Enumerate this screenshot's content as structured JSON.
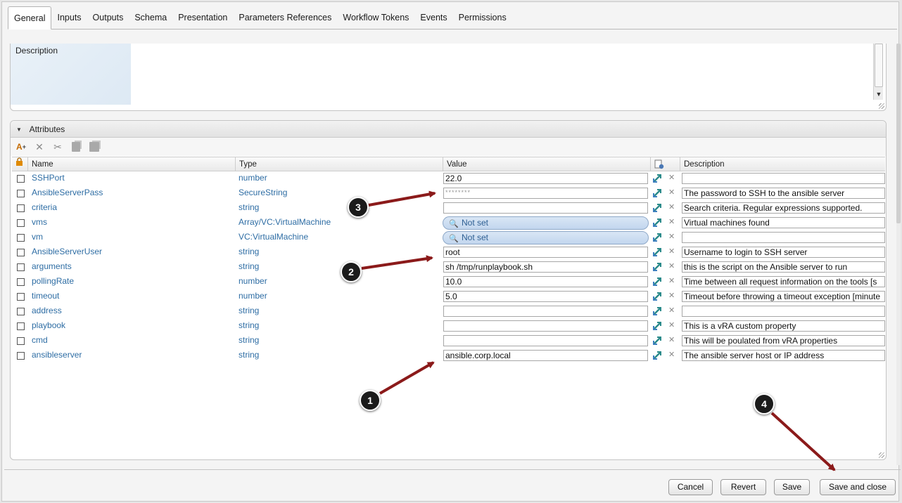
{
  "tabs": [
    {
      "label": "General",
      "active": true
    },
    {
      "label": "Inputs"
    },
    {
      "label": "Outputs"
    },
    {
      "label": "Schema"
    },
    {
      "label": "Presentation"
    },
    {
      "label": "Parameters References"
    },
    {
      "label": "Workflow Tokens"
    },
    {
      "label": "Events"
    },
    {
      "label": "Permissions"
    }
  ],
  "description": {
    "label": "Description"
  },
  "attributes": {
    "title": "Attributes",
    "columns": {
      "name": "Name",
      "type": "Type",
      "value": "Value",
      "description": "Description"
    },
    "rows": [
      {
        "name": "SSHPort",
        "type": "number",
        "value": "22.0",
        "description": ""
      },
      {
        "name": "AnsibleServerPass",
        "type": "SecureString",
        "value": "********",
        "description": "The password to SSH to the ansible server",
        "secure": true
      },
      {
        "name": "criteria",
        "type": "string",
        "value": "",
        "description": "Search criteria. Regular expressions supported."
      },
      {
        "name": "vms",
        "type": "Array/VC:VirtualMachine",
        "value": "Not set",
        "description": "Virtual machines found",
        "picker": true
      },
      {
        "name": "vm",
        "type": "VC:VirtualMachine",
        "value": "Not set",
        "description": "",
        "picker": true
      },
      {
        "name": "AnsibleServerUser",
        "type": "string",
        "value": "root",
        "description": "Username to login to SSH server"
      },
      {
        "name": "arguments",
        "type": "string",
        "value": "sh /tmp/runplaybook.sh",
        "description": "this is the script on the Ansible server to run"
      },
      {
        "name": "pollingRate",
        "type": "number",
        "value": "10.0",
        "description": "Time between all request information on the tools [s"
      },
      {
        "name": "timeout",
        "type": "number",
        "value": "5.0",
        "description": "Timeout before throwing a timeout exception [minute"
      },
      {
        "name": "address",
        "type": "string",
        "value": "",
        "description": ""
      },
      {
        "name": "playbook",
        "type": "string",
        "value": "",
        "description": "This is a vRA custom property"
      },
      {
        "name": "cmd",
        "type": "string",
        "value": "",
        "description": "This will be poulated from vRA properties"
      },
      {
        "name": "ansibleserver",
        "type": "string",
        "value": "ansible.corp.local",
        "description": "The ansible server host or IP address"
      }
    ]
  },
  "buttons": {
    "cancel": "Cancel",
    "revert": "Revert",
    "save": "Save",
    "save_close": "Save and close"
  },
  "markers": [
    "1",
    "2",
    "3",
    "4"
  ],
  "colors": {
    "link": "#2e6da4",
    "arrow": "#8b1a1a",
    "picker": "#c2d6ee"
  }
}
